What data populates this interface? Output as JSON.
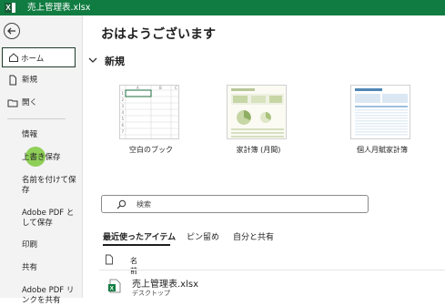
{
  "window": {
    "title": "売上管理表.xlsx"
  },
  "colors": {
    "brand": "#107c41",
    "highlight": "#7cc83c"
  },
  "sidebar": {
    "home": "ホーム",
    "new": "新規",
    "open": "開く",
    "info": "情報",
    "save": "上書き保存",
    "save_as": "名前を付けて保\n存",
    "save_pdf": "Adobe PDF と\nして保存",
    "print": "印刷",
    "share": "共有",
    "share_pdf": "Adobe PDF リ\nンクを共有"
  },
  "main": {
    "greeting": "おはようございます",
    "new_section": "新規",
    "templates": [
      {
        "label": "空白のブック"
      },
      {
        "label": "家計簿 (月間)"
      },
      {
        "label": "個人月賦家計簿"
      }
    ],
    "search_placeholder": "検索",
    "tabs": [
      "最近使ったアイテム",
      "ピン留め",
      "自分と共有"
    ],
    "list_header": "名前",
    "recent_files": [
      {
        "name": "売上管理表.xlsx",
        "location": "デスクトップ"
      }
    ]
  }
}
